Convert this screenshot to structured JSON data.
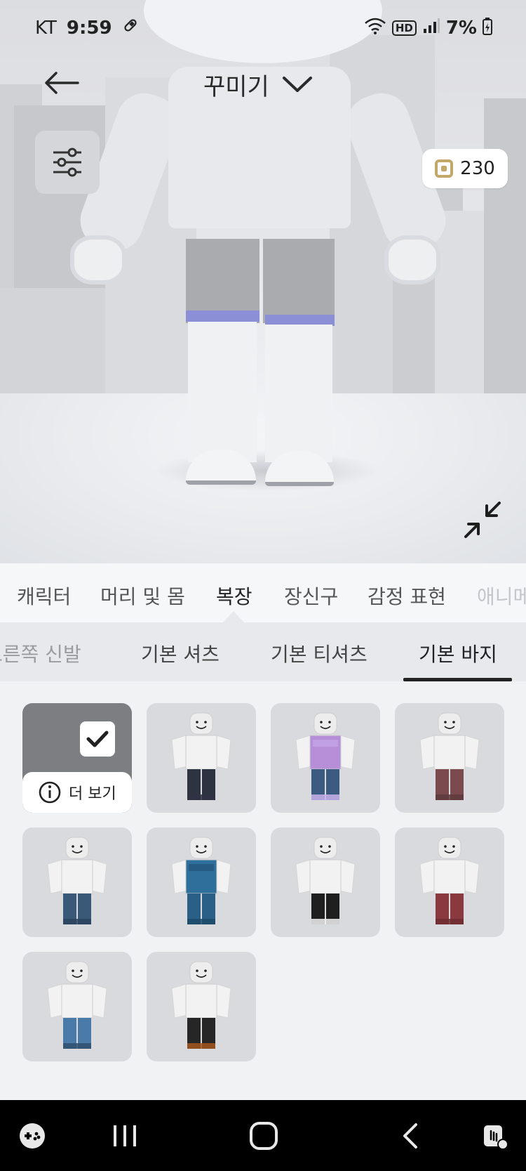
{
  "status_bar": {
    "carrier": "KT",
    "time": "9:59",
    "hd_label": "HD",
    "battery": "7%"
  },
  "header": {
    "title": "꾸미기",
    "robux_balance": "230"
  },
  "categories": [
    {
      "label": "캐릭터",
      "active": false
    },
    {
      "label": "머리 및 몸",
      "active": false
    },
    {
      "label": "복장",
      "active": true
    },
    {
      "label": "장신구",
      "active": false
    },
    {
      "label": "감정 표현",
      "active": false
    },
    {
      "label": "애니메",
      "active": false
    }
  ],
  "subcategories": [
    {
      "label": "오른쪽 신발",
      "active": false
    },
    {
      "label": "기본 셔츠",
      "active": false
    },
    {
      "label": "기본 티셔츠",
      "active": false
    },
    {
      "label": "기본 바지",
      "active": true
    }
  ],
  "items": [
    {
      "name": "selected-item",
      "selected": true,
      "more_label": "더 보기"
    },
    {
      "name": "dark-navy-pants",
      "shirt": "#f2f2f2",
      "pants": "#2e3342",
      "accent": "#2e3342"
    },
    {
      "name": "galaxy-top-denim-shorts",
      "shirt": "#b78fd8",
      "pants": "#3b5c80",
      "accent": "#c9b2ec"
    },
    {
      "name": "maroon-camo-pants",
      "shirt": "#f2f2f2",
      "pants": "#7a4a4e",
      "accent": "#5e3a3c"
    },
    {
      "name": "blue-denim-pants",
      "shirt": "#f2f2f2",
      "pants": "#3a5878",
      "accent": "#2c445e"
    },
    {
      "name": "blue-brick-overalls",
      "shirt": "#2f6f9c",
      "pants": "#2a5f87",
      "accent": "#1d4a6a"
    },
    {
      "name": "black-shorts",
      "shirt": "#f2f2f2",
      "pants": "#1f1f1f",
      "accent": "#f2f2f2"
    },
    {
      "name": "dark-red-pants",
      "shirt": "#f2f2f2",
      "pants": "#8a3a3f",
      "accent": "#6e2d31"
    },
    {
      "name": "ripped-denim-shorts",
      "shirt": "#f2f2f2",
      "pants": "#4a7aa8",
      "accent": "#2e4f70"
    },
    {
      "name": "black-pants-flame",
      "shirt": "#f2f2f2",
      "pants": "#262626",
      "accent": "#a4561e"
    }
  ]
}
